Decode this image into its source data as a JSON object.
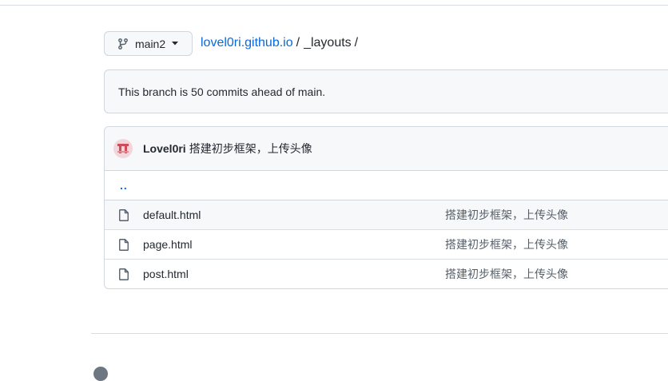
{
  "branch": {
    "name": "main2"
  },
  "breadcrumb": {
    "repo": "lovel0ri.github.io",
    "sep1": "/",
    "folder": "_layouts",
    "sep2": "/"
  },
  "notice": {
    "text": "This branch is 50 commits ahead of main."
  },
  "commit": {
    "author": "Lovel0ri",
    "message": "搭建初步框架，上传头像"
  },
  "parent_dir": {
    "label": ".."
  },
  "files": [
    {
      "name": "default.html",
      "message": "搭建初步框架，上传头像"
    },
    {
      "name": "page.html",
      "message": "搭建初步框架，上传头像"
    },
    {
      "name": "post.html",
      "message": "搭建初步框架，上传头像"
    }
  ],
  "colors": {
    "link": "#0969da",
    "border": "#d0d7de",
    "muted_bg": "#f6f8fa",
    "avatar_red": "#cf4d5a"
  }
}
